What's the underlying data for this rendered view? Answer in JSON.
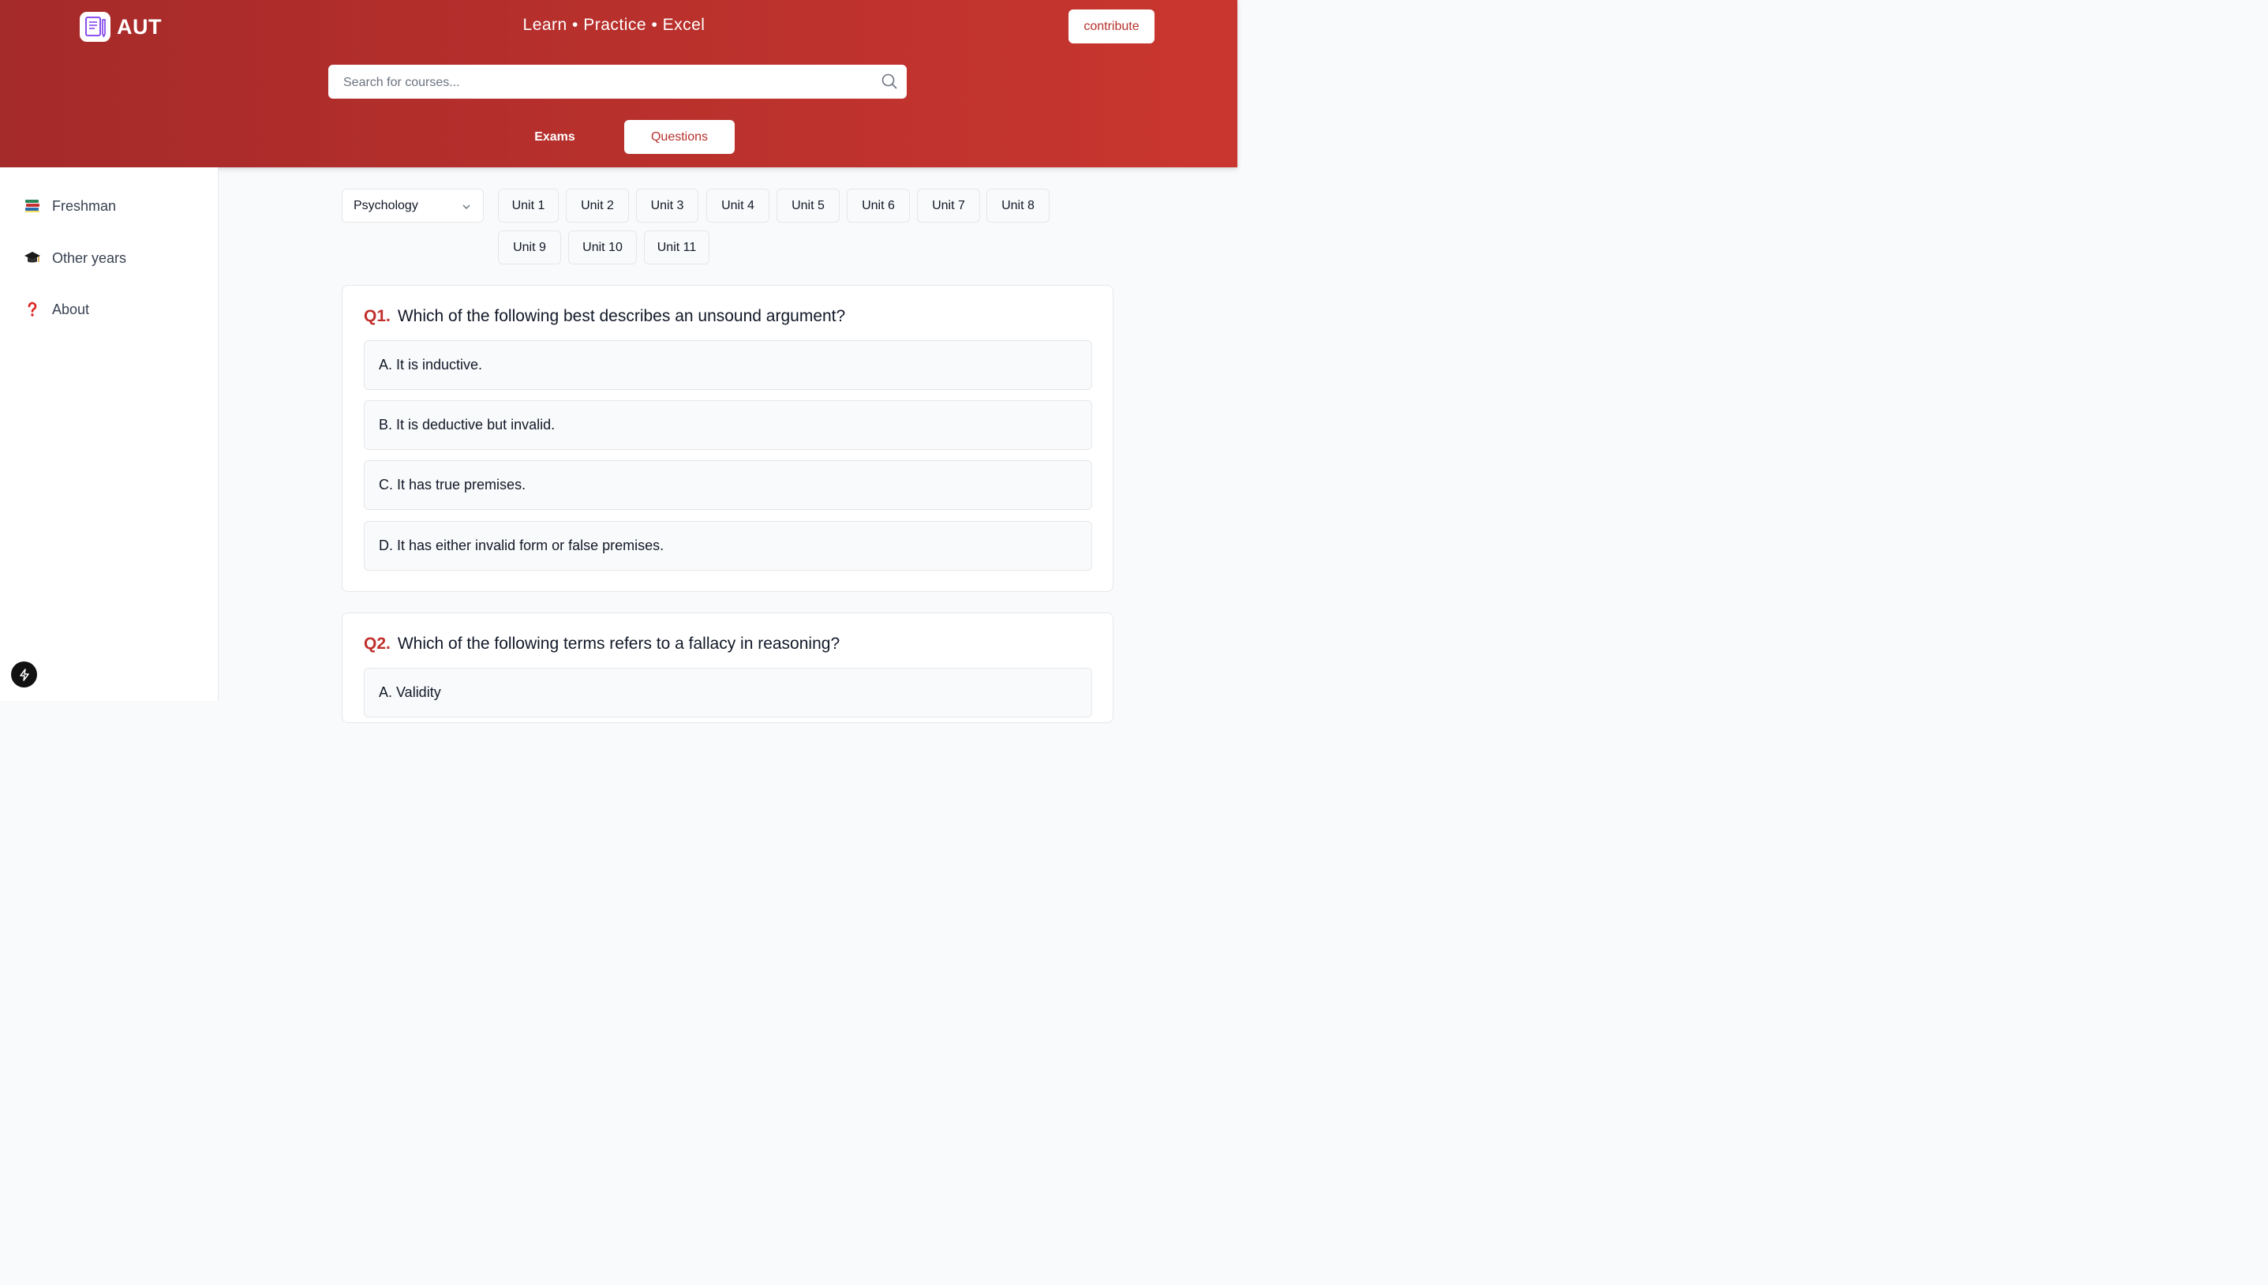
{
  "header": {
    "logo_text": "AUT",
    "tagline": "Learn • Practice • Excel",
    "contribute_label": "contribute",
    "search_placeholder": "Search for courses...",
    "tabs": [
      {
        "label": "Exams",
        "active": false
      },
      {
        "label": "Questions",
        "active": true
      }
    ]
  },
  "sidebar": {
    "items": [
      {
        "label": "Freshman",
        "icon": "books-icon"
      },
      {
        "label": "Other years",
        "icon": "graduation-cap-icon"
      },
      {
        "label": "About",
        "icon": "question-mark-icon"
      }
    ]
  },
  "filters": {
    "course_selected": "Psychology",
    "units": [
      "Unit 1",
      "Unit 2",
      "Unit 3",
      "Unit 4",
      "Unit 5",
      "Unit 6",
      "Unit 7",
      "Unit 8",
      "Unit 9",
      "Unit 10",
      "Unit 11"
    ]
  },
  "questions": [
    {
      "number": "Q1.",
      "text": "Which of the following best describes an unsound argument?",
      "options": [
        "A. It is inductive.",
        "B. It is deductive but invalid.",
        "C. It has true premises.",
        "D. It has either invalid form or false premises."
      ]
    },
    {
      "number": "Q2.",
      "text": "Which of the following terms refers to a fallacy in reasoning?",
      "options": [
        "A. Validity"
      ]
    }
  ],
  "colors": {
    "brand": "#b8302c",
    "accent_text": "#c0302b"
  }
}
